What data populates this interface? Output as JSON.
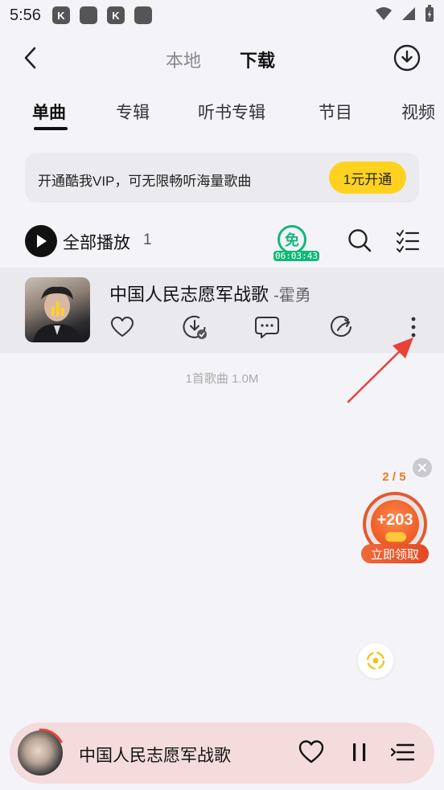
{
  "status_bar": {
    "time": "5:56"
  },
  "header": {
    "tab_local": "本地",
    "tab_download": "下载"
  },
  "category_tabs": [
    {
      "label": "单曲",
      "active": true
    },
    {
      "label": "专辑",
      "active": false
    },
    {
      "label": "听书专辑",
      "active": false
    },
    {
      "label": "节目",
      "active": false
    },
    {
      "label": "视频",
      "active": false
    }
  ],
  "vip_banner": {
    "text": "开通酷我VIP，可无限畅听海量歌曲",
    "button": "1元开通",
    "button_color": "#ffd21f"
  },
  "play_all": {
    "label": "全部播放",
    "count": "1"
  },
  "free_badge": {
    "glyph": "免",
    "timer": "06:03:43",
    "color": "#12b878"
  },
  "song": {
    "title": "中国人民志愿军战歌",
    "artist": "-霍勇"
  },
  "summary": "1首歌曲 1.0M",
  "reward": {
    "progress": "2 / 5",
    "amount": "+203",
    "claim": "立即领取",
    "accent": "#e25a2e"
  },
  "mini_player": {
    "title": "中国人民志愿军战歌",
    "background": "#f4dcdc"
  },
  "annotation": {
    "arrow_color": "#e8413a"
  }
}
